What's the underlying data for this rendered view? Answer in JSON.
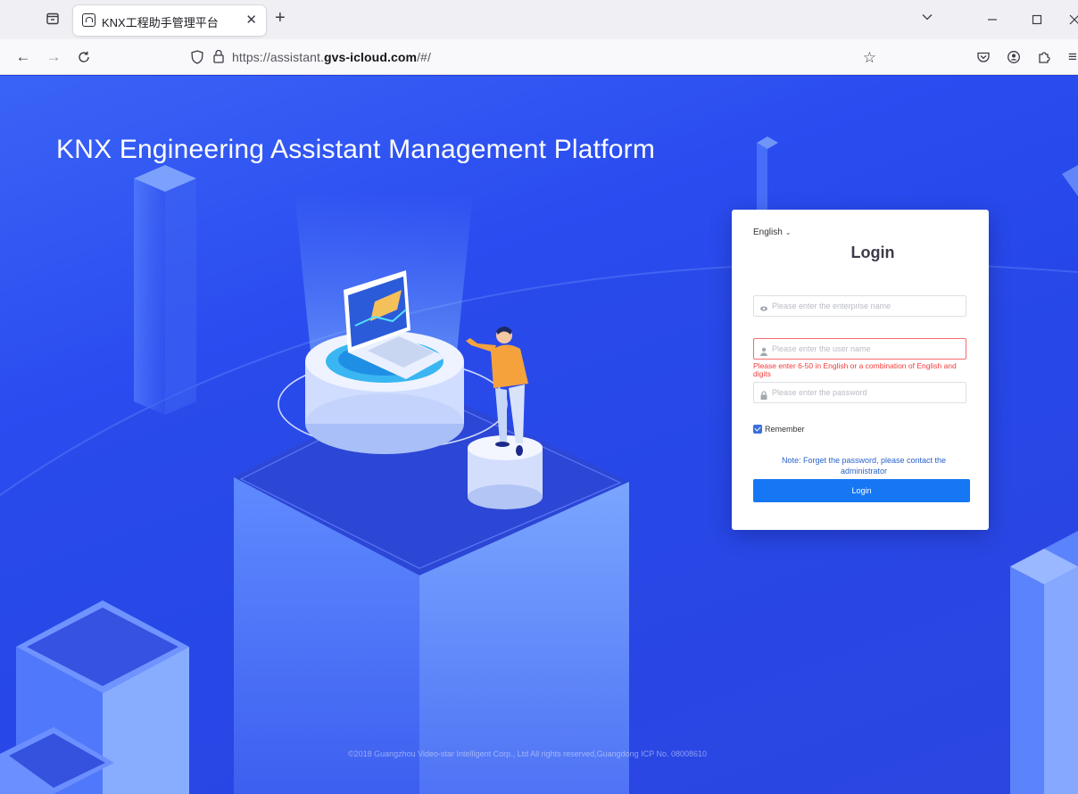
{
  "browser": {
    "tab_title": "KNX工程助手管理平台",
    "url_prefix": "https://assistant.",
    "url_domain": "gvs-icloud.com",
    "url_suffix": "/#/"
  },
  "page": {
    "title": "KNX Engineering Assistant Management Platform",
    "footer": "©2018 Guangzhou Video-star Intelligent Corp., Ltd All rights reserved,Guangdong ICP No. 08008610"
  },
  "login": {
    "language": "English",
    "title": "Login",
    "enterprise_placeholder": "Please enter the enterprise name",
    "username_placeholder": "Please enter the user name",
    "username_error": "Please enter 6-50 in English or a combination of English and digits",
    "password_placeholder": "Please enter the password",
    "remember_label": "Remember",
    "remember_checked": true,
    "note": "Note: Forget the password, please contact the administrator",
    "button_label": "Login"
  },
  "colors": {
    "accent": "#1677f5",
    "error": "#f23b3b",
    "background": "#2444e6"
  }
}
